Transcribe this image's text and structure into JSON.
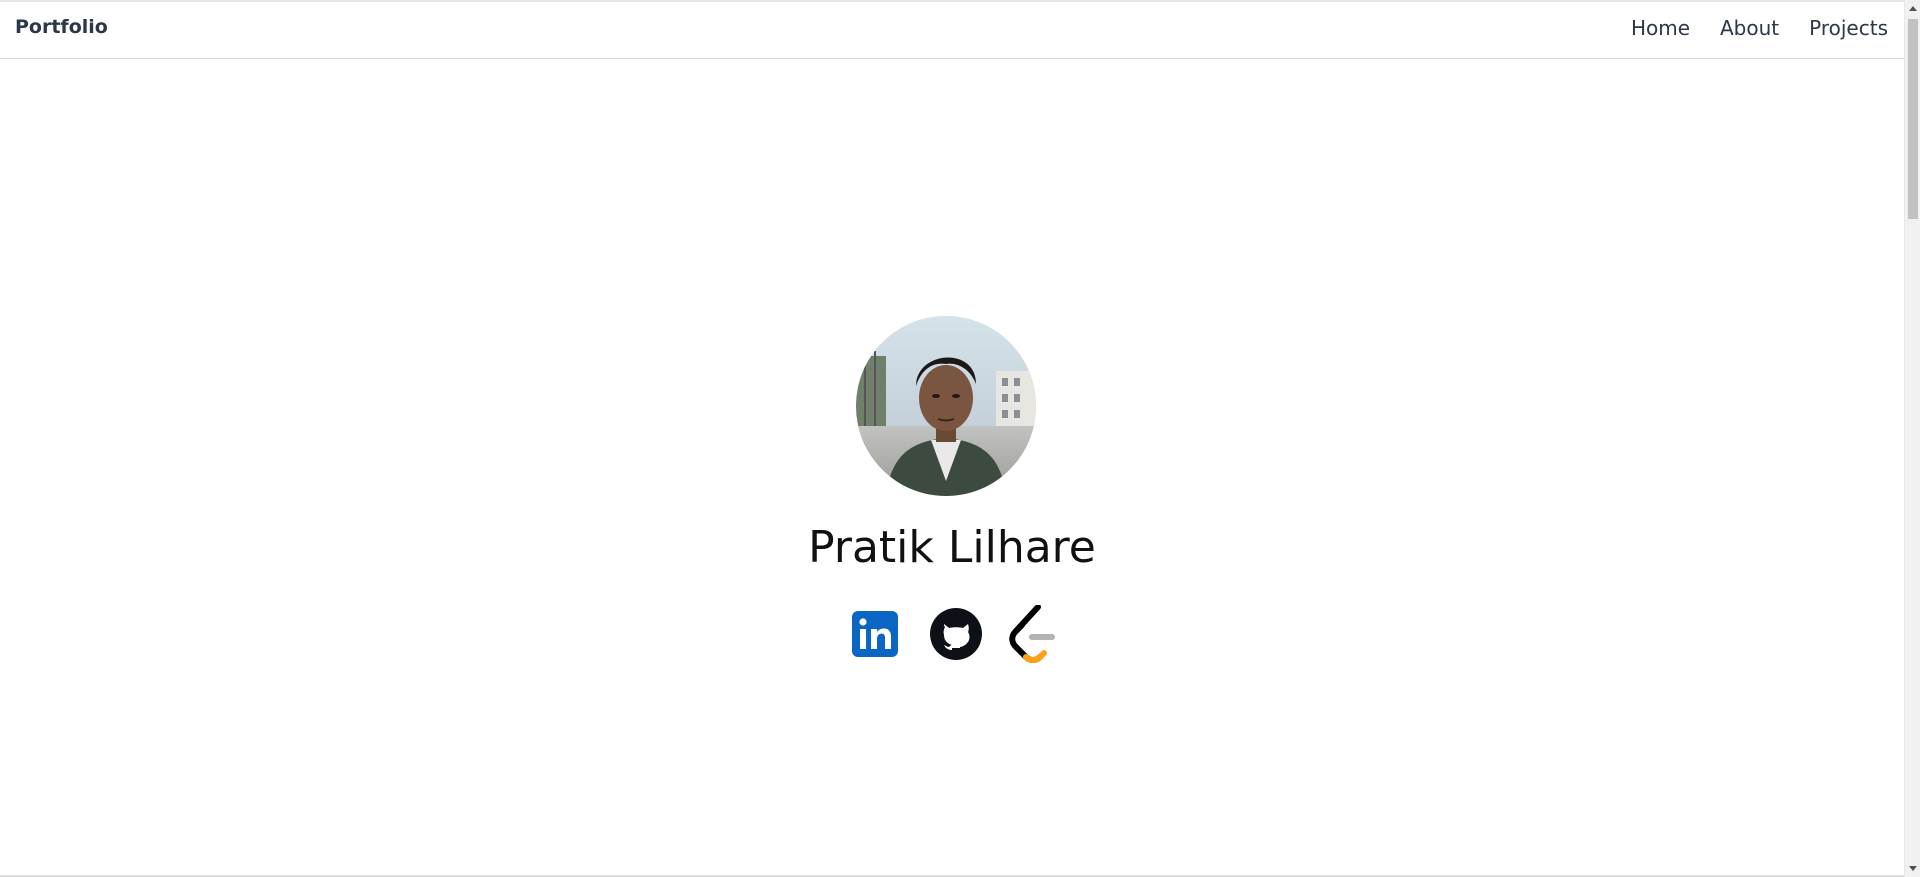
{
  "navbar": {
    "brand": "Portfolio",
    "links": [
      "Home",
      "About",
      "Projects"
    ]
  },
  "hero": {
    "name": "Pratik Lilhare",
    "avatar_icon": "profile-photo",
    "socials": [
      {
        "icon": "linkedin-icon",
        "label": "in"
      },
      {
        "icon": "github-icon"
      },
      {
        "icon": "leetcode-icon"
      }
    ]
  },
  "colors": {
    "nav_text": "#2d3748",
    "linkedin": "#0a66c2",
    "leetcode_orange": "#ffa116"
  }
}
